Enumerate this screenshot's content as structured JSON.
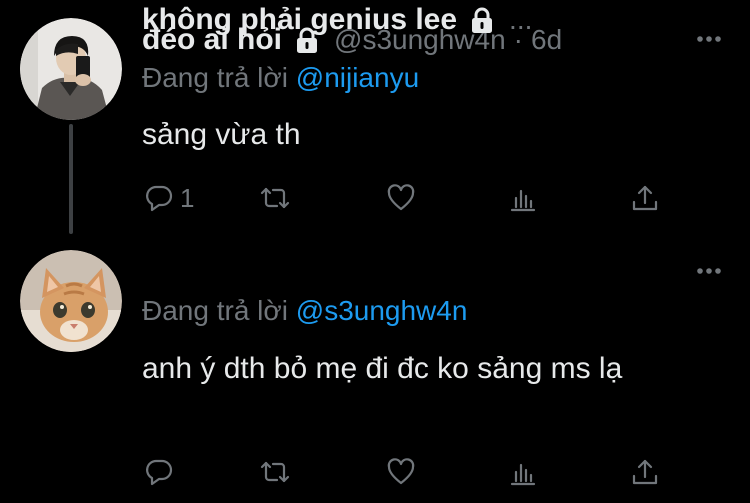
{
  "tweets": [
    {
      "display_name": "đéo ai hỏi",
      "handle": "@s3unghw4n",
      "dot": "·",
      "time": "6d",
      "replying_prefix": "Đang trả lời",
      "replying_to": "@nijianyu",
      "text": "sảng vừa th",
      "reply_count": "1",
      "retweet_count": "",
      "like_count": ""
    },
    {
      "display_name": "không phải genius lee",
      "truncation": "...",
      "replying_prefix": "Đang trả lời",
      "replying_to": "@s3unghw4n",
      "text": "anh ý dth bỏ mẹ đi đc ko sảng ms lạ",
      "reply_count": "",
      "retweet_count": "",
      "like_count": ""
    }
  ],
  "icons": {
    "lock": "lock-icon",
    "more": "more-horizontal-icon",
    "reply": "reply-icon",
    "retweet": "retweet-icon",
    "like": "heart-icon",
    "analytics": "analytics-icon",
    "share": "share-icon"
  },
  "colors": {
    "background": "#000000",
    "text": "#e7e9ea",
    "secondary": "#71767b",
    "accent": "#1d9bf0",
    "thread_line": "#3d4043"
  }
}
